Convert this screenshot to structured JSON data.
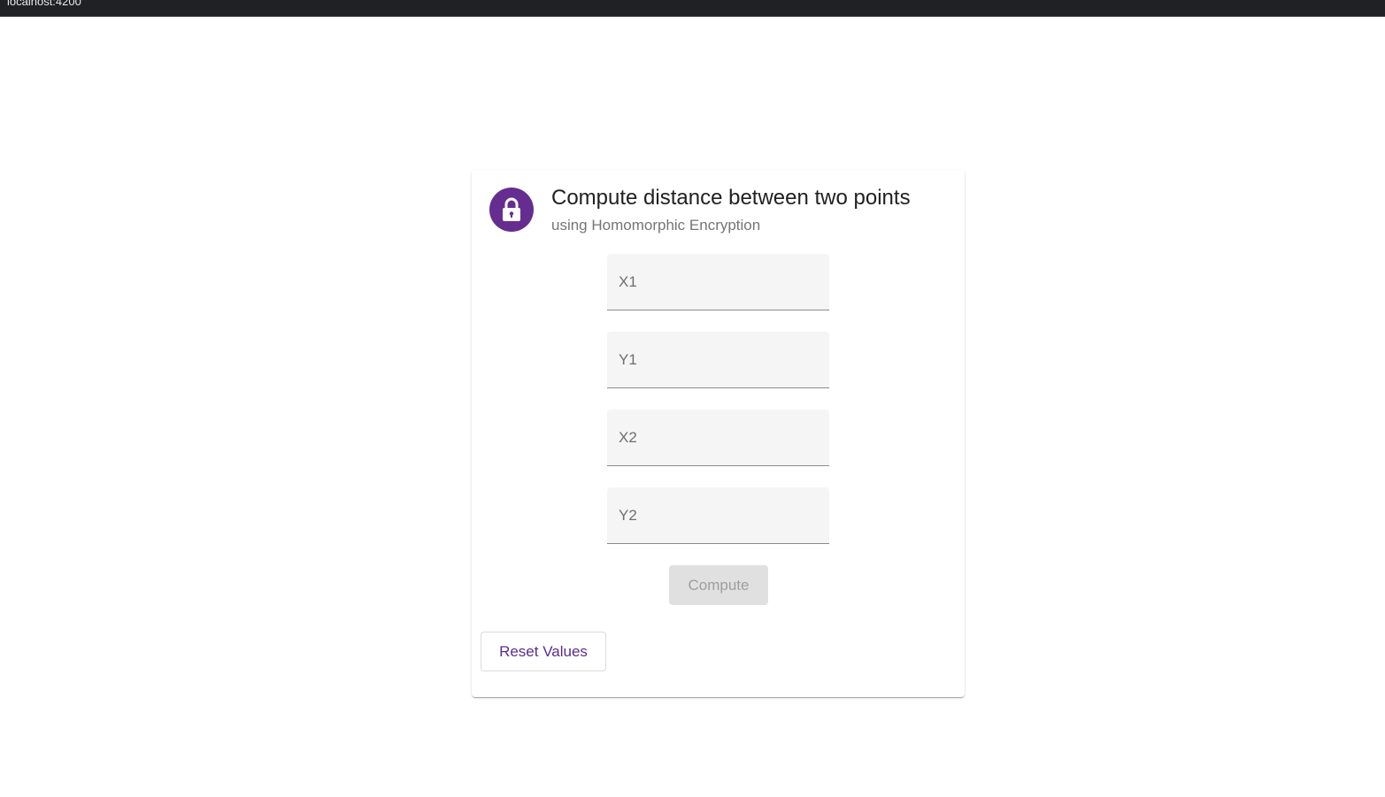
{
  "browser": {
    "url_text": "localhost:4200"
  },
  "card": {
    "title": "Compute distance between two points",
    "subtitle": "using Homomorphic Encryption",
    "avatar_icon": "lock-icon",
    "accent_color": "#662d91"
  },
  "fields": {
    "x1": {
      "placeholder": "X1",
      "value": ""
    },
    "y1": {
      "placeholder": "Y1",
      "value": ""
    },
    "x2": {
      "placeholder": "X2",
      "value": ""
    },
    "y2": {
      "placeholder": "Y2",
      "value": ""
    }
  },
  "actions": {
    "compute_label": "Compute",
    "compute_disabled": true,
    "reset_label": "Reset Values"
  }
}
